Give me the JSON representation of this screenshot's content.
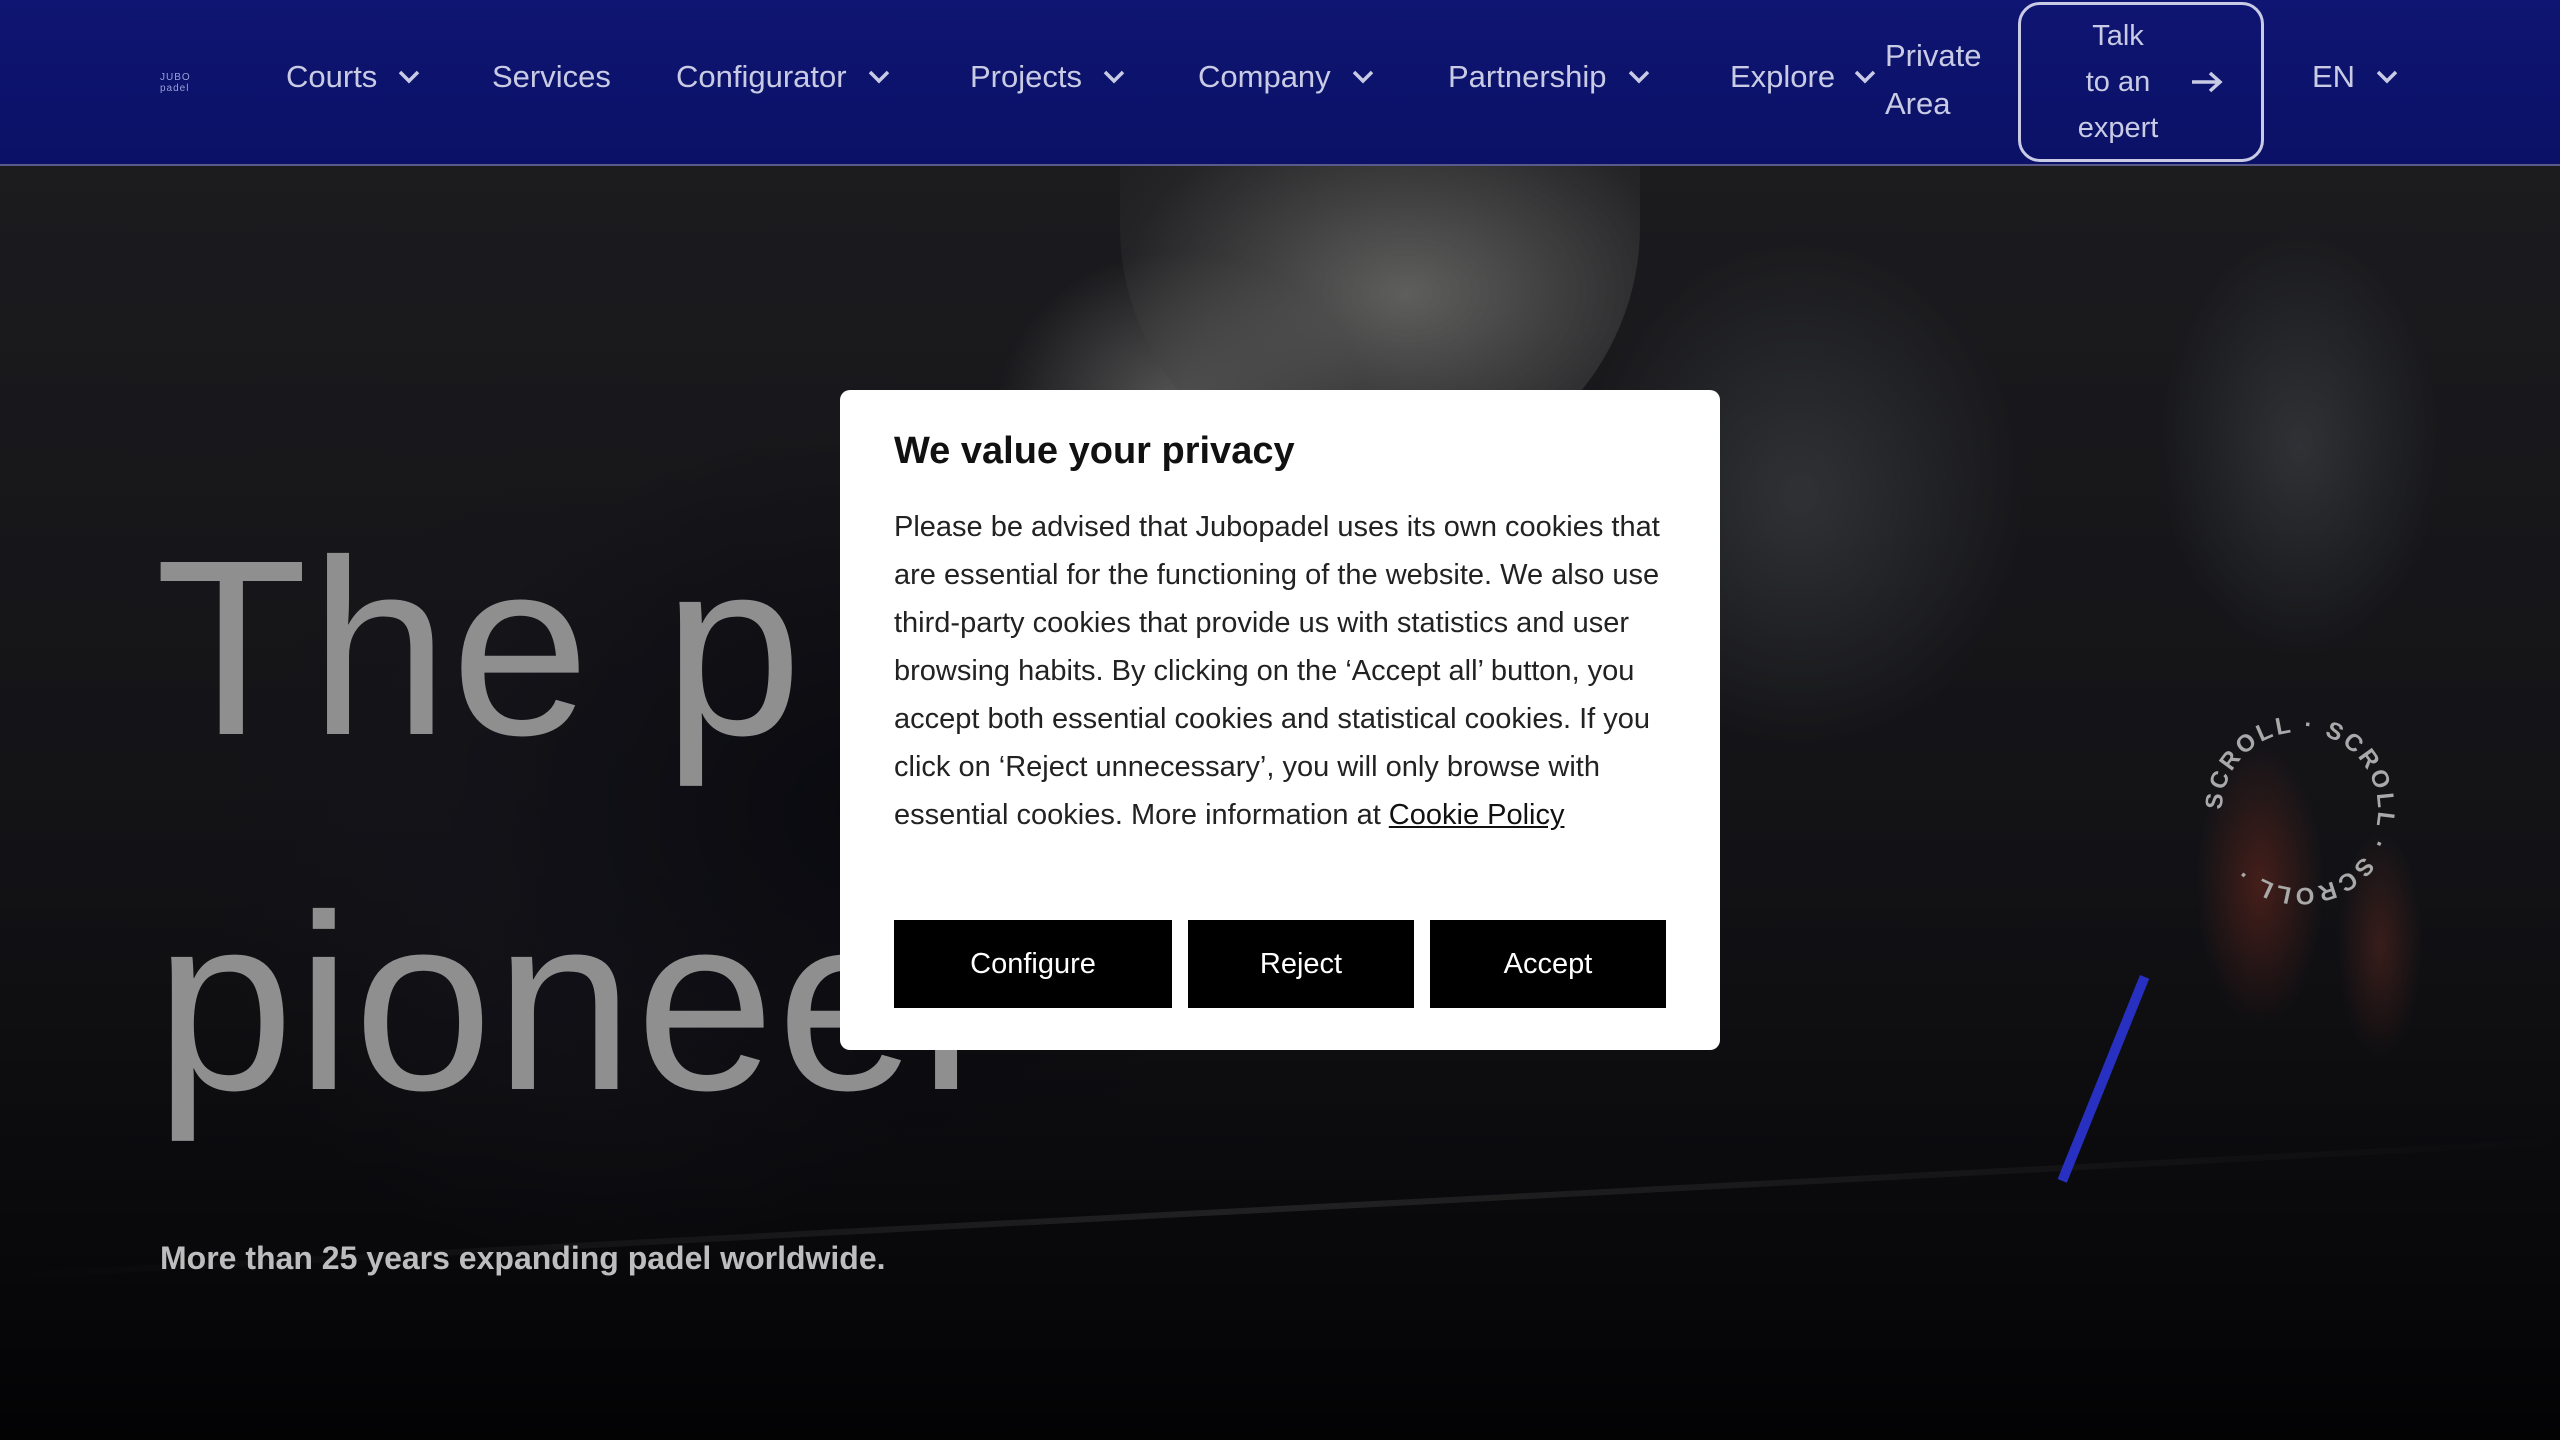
{
  "header": {
    "logo_text": "JUBO padel",
    "nav": [
      {
        "label": "Courts",
        "dropdown": true
      },
      {
        "label": "Services",
        "dropdown": false
      },
      {
        "label": "Configurator",
        "dropdown": true
      },
      {
        "label": "Projects",
        "dropdown": true
      },
      {
        "label": "Company",
        "dropdown": true
      },
      {
        "label": "Partnership",
        "dropdown": true
      },
      {
        "label": "Explore",
        "dropdown": true
      }
    ],
    "private_area": {
      "line1": "Private",
      "line2": "Area"
    },
    "expert_button": {
      "line1": "Talk",
      "line2": "to an",
      "line3": "expert",
      "icon": "arrow-right-icon"
    },
    "language": {
      "label": "EN",
      "icon": "chevron-down-icon"
    }
  },
  "hero": {
    "headline_line1": "The p",
    "headline_line2": "pioneer",
    "subline": "More than 25 years expanding padel worldwide.",
    "scroll_text": "SCROLL · SCROLL · SCROLL ·"
  },
  "cookie_modal": {
    "title": "We value your privacy",
    "body": "Please be advised that Jubopadel uses its own cookies that are essential for the functioning of the website. We also use third-party cookies that provide us with statistics and user browsing habits. By clicking on the ‘Accept all’ button, you accept both essential cookies and statistical cookies. If you click on ‘Reject unnecessary’, you will only browse with essential cookies. More information at",
    "link_text": "Cookie Policy",
    "buttons": {
      "configure": "Configure",
      "reject": "Reject",
      "accept": "Accept"
    }
  },
  "colors": {
    "header_bg": "#0e1572",
    "nav_text": "#c9cbe5",
    "modal_bg": "#ffffff",
    "button_bg": "#000000",
    "scroll_accent": "#2730c0"
  }
}
